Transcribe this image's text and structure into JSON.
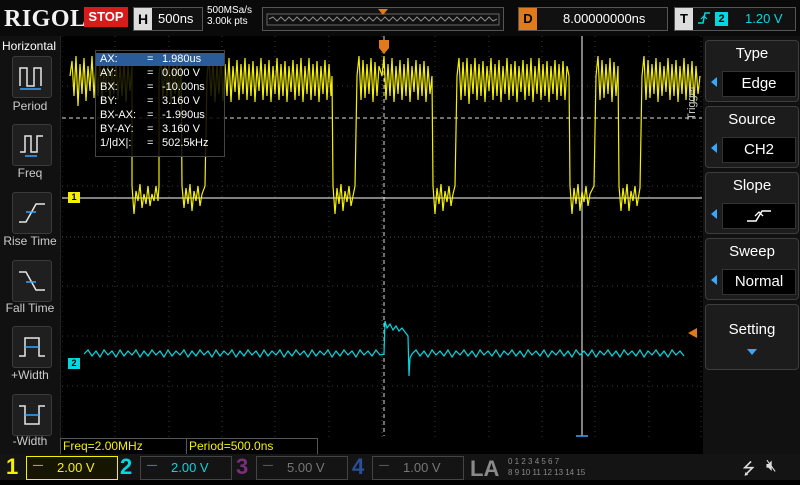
{
  "header": {
    "logo": "RIGOL",
    "run_state": "STOP",
    "horizontal_label": "H",
    "timebase": "500ns",
    "sample_rate": "500MSa/s",
    "memory_depth": "3.00k pts",
    "delay_label": "D",
    "delay_value": "8.00000000ns",
    "trigger_label": "T",
    "trigger_source_num": "2",
    "trigger_level": "1.20 V"
  },
  "left_menu": {
    "title": "Horizontal",
    "items": [
      {
        "label": "Period",
        "icon": "period-icon"
      },
      {
        "label": "Freq",
        "icon": "freq-icon"
      },
      {
        "label": "Rise Time",
        "icon": "rise-time-icon"
      },
      {
        "label": "Fall Time",
        "icon": "fall-time-icon"
      },
      {
        "label": "+Width",
        "icon": "pos-width-icon"
      },
      {
        "label": "-Width",
        "icon": "neg-width-icon"
      }
    ]
  },
  "cursors": [
    {
      "key": "AX:",
      "value": "1.980us"
    },
    {
      "key": "AY:",
      "value": "0.000 V"
    },
    {
      "key": "BX:",
      "value": "-10.00ns"
    },
    {
      "key": "BY:",
      "value": "3.160 V"
    },
    {
      "key": "BX-AX:",
      "value": "-1.990us"
    },
    {
      "key": "BY-AY:",
      "value": "3.160 V"
    },
    {
      "key": "1/|dX|:",
      "value": "502.5kHz"
    }
  ],
  "channel_markers": {
    "ch1": "1",
    "ch2": "2"
  },
  "right_menu": {
    "title": "Trigger",
    "items": [
      {
        "title": "Type",
        "value": "Edge"
      },
      {
        "title": "Source",
        "value": "CH2"
      },
      {
        "title": "Slope",
        "value": ""
      },
      {
        "title": "Sweep",
        "value": "Normal"
      },
      {
        "title": "Setting",
        "value": ""
      }
    ]
  },
  "measurements": {
    "freq": "Freq=2.00MHz",
    "period": "Period=500.0ns"
  },
  "channels": [
    {
      "num": "1",
      "coupling": "—",
      "scale": "2.00 V",
      "color": "#f5f000"
    },
    {
      "num": "2",
      "coupling": "—",
      "scale": "2.00 V",
      "color": "#00d8e0"
    },
    {
      "num": "3",
      "coupling": "—",
      "scale": "5.00 V",
      "color": "#c040c0"
    },
    {
      "num": "4",
      "coupling": "—",
      "scale": "1.00 V",
      "color": "#3a6fd8"
    }
  ],
  "logic_analyzer": {
    "label": "LA",
    "bits_row1": "0 1 2 3 4 5 6 7",
    "bits_row2": "8 9 10 11 12 13 14 15"
  },
  "colors": {
    "ch1": "#f5f000",
    "ch2": "#00d8e0",
    "trigger_marker": "#e07a1a",
    "menu_accent": "#39a6ff",
    "stop": "#d81c1c"
  }
}
